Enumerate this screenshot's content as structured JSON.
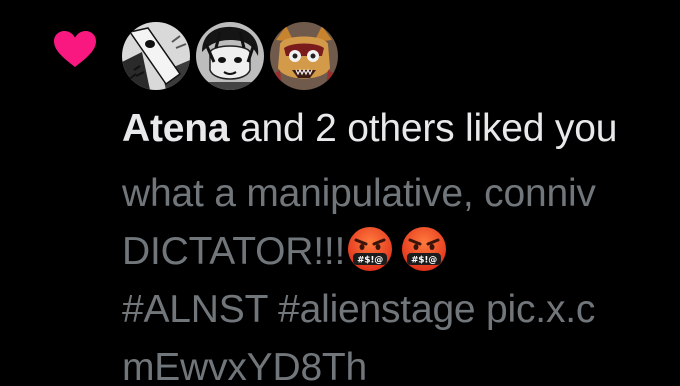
{
  "notification": {
    "icon": "heart-icon",
    "icon_color": "#f91880",
    "avatars": [
      {
        "icon": "avatar-hand-drawing"
      },
      {
        "icon": "avatar-manga-character"
      },
      {
        "icon": "avatar-creature-mask"
      }
    ],
    "liker_name": "Atena",
    "summary_text": " and 2 others liked you",
    "tweet_lines": [
      "what a manipulative, conniv",
      "DICTATOR!!!",
      "#ALNST #alienstage pic.x.c",
      "mEwvxYD8Th"
    ],
    "emoji": [
      "face-with-symbols-on-mouth",
      "face-with-symbols-on-mouth"
    ],
    "emoji_text": "#$!@",
    "text_color_primary": "#e7e9ea",
    "text_color_secondary": "#71767b"
  }
}
